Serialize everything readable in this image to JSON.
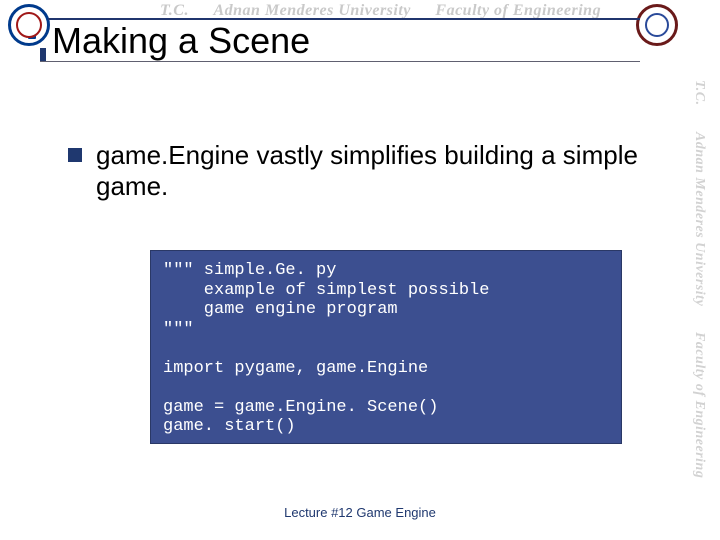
{
  "watermark": {
    "tc": "T.C.",
    "university": "Adnan Menderes University",
    "faculty": "Faculty of Engineering"
  },
  "title": "Making a Scene",
  "bullet": "game.Engine vastly simplifies building a simple game.",
  "code": "\"\"\" simple.Ge. py\n    example of simplest possible\n    game engine program\n\"\"\"\n\nimport pygame, game.Engine\n\ngame = game.Engine. Scene()\ngame. start()",
  "footer": "Lecture #12 Game Engine"
}
